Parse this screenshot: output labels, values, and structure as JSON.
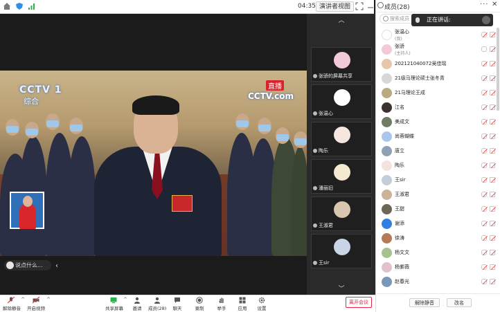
{
  "topbar": {
    "time": "04:35",
    "view_label": "演讲者视图",
    "icons": [
      "home-icon",
      "shield-icon",
      "signal-icon",
      "fullscreen-icon",
      "minimize-icon",
      "restore-icon",
      "close-icon"
    ]
  },
  "video": {
    "logo_left": "CCTV 1",
    "logo_left_sub": "综合",
    "logo_right": "CCTV.com",
    "live": "直播"
  },
  "chat": {
    "placeholder": "说点什么..."
  },
  "strip": {
    "tiles": [
      {
        "label": "张骄的屏幕共享"
      },
      {
        "label": "张温心"
      },
      {
        "label": "陶乐"
      },
      {
        "label": "潘丽旧"
      },
      {
        "label": "王淑君"
      },
      {
        "label": "王sir"
      }
    ]
  },
  "panel": {
    "title": "成员(28)",
    "search_placeholder": "搜索成员",
    "speaking_label": "正在讲话:",
    "members": [
      {
        "name": "张温心",
        "role": "(我)"
      },
      {
        "name": "张骄",
        "role": "(主持人)"
      },
      {
        "name": "202121040072吴佳瑶",
        "role": ""
      },
      {
        "name": "21级马理论硕士张冬青",
        "role": ""
      },
      {
        "name": "21马理论王成",
        "role": ""
      },
      {
        "name": "江名",
        "role": ""
      },
      {
        "name": "美成文",
        "role": ""
      },
      {
        "name": "尚蓉蝴蝶",
        "role": ""
      },
      {
        "name": "唐立",
        "role": ""
      },
      {
        "name": "陶乐",
        "role": ""
      },
      {
        "name": "王sir",
        "role": ""
      },
      {
        "name": "王淑君",
        "role": ""
      },
      {
        "name": "王甜",
        "role": ""
      },
      {
        "name": "谢添",
        "role": ""
      },
      {
        "name": "徐涛",
        "role": ""
      },
      {
        "name": "杨文文",
        "role": ""
      },
      {
        "name": "杨紫薇",
        "role": ""
      },
      {
        "name": "赵春光",
        "role": ""
      }
    ],
    "unmute_btn": "解除静音",
    "rename_btn": "改名"
  },
  "toolbar": {
    "items": [
      {
        "label": "解除静音",
        "icon": "mic-off-icon"
      },
      {
        "label": "开启视频",
        "icon": "camera-off-icon"
      },
      {
        "label": "共享屏幕",
        "icon": "share-screen-icon"
      },
      {
        "label": "邀请",
        "icon": "invite-icon"
      },
      {
        "label": "成员(28)",
        "icon": "members-icon"
      },
      {
        "label": "聊天",
        "icon": "chat-icon"
      },
      {
        "label": "录制",
        "icon": "record-icon"
      },
      {
        "label": "举手",
        "icon": "hand-icon"
      },
      {
        "label": "应用",
        "icon": "apps-icon"
      },
      {
        "label": "设置",
        "icon": "settings-icon"
      }
    ],
    "leave_label": "离开会议"
  }
}
